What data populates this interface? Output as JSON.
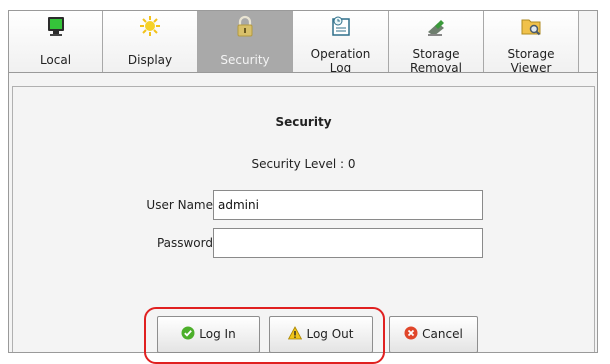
{
  "tabs": [
    {
      "label": "Local",
      "icon": "monitor-icon",
      "active": false
    },
    {
      "label": "Display",
      "icon": "sun-icon",
      "active": false
    },
    {
      "label": "Security",
      "icon": "padlock-icon",
      "active": true
    },
    {
      "label": "Operation\nLog",
      "icon": "operation-log-icon",
      "active": false
    },
    {
      "label": "Storage\nRemoval",
      "icon": "storage-removal-icon",
      "active": false
    },
    {
      "label": "Storage\nViewer",
      "icon": "folder-viewer-icon",
      "active": false
    }
  ],
  "panel": {
    "title": "Security",
    "security_level": "Security Level : 0"
  },
  "form": {
    "user_label": "User Name",
    "user_value": "admini",
    "password_label": "Password",
    "password_value": ""
  },
  "buttons": {
    "login": "Log In",
    "logout": "Log Out",
    "cancel": "Cancel"
  },
  "colors": {
    "active_tab": "#a9a9a9",
    "highlight": "#e02020",
    "login_icon": "#4caf2a",
    "logout_icon": "#f0c419",
    "cancel_icon": "#e0462a"
  }
}
